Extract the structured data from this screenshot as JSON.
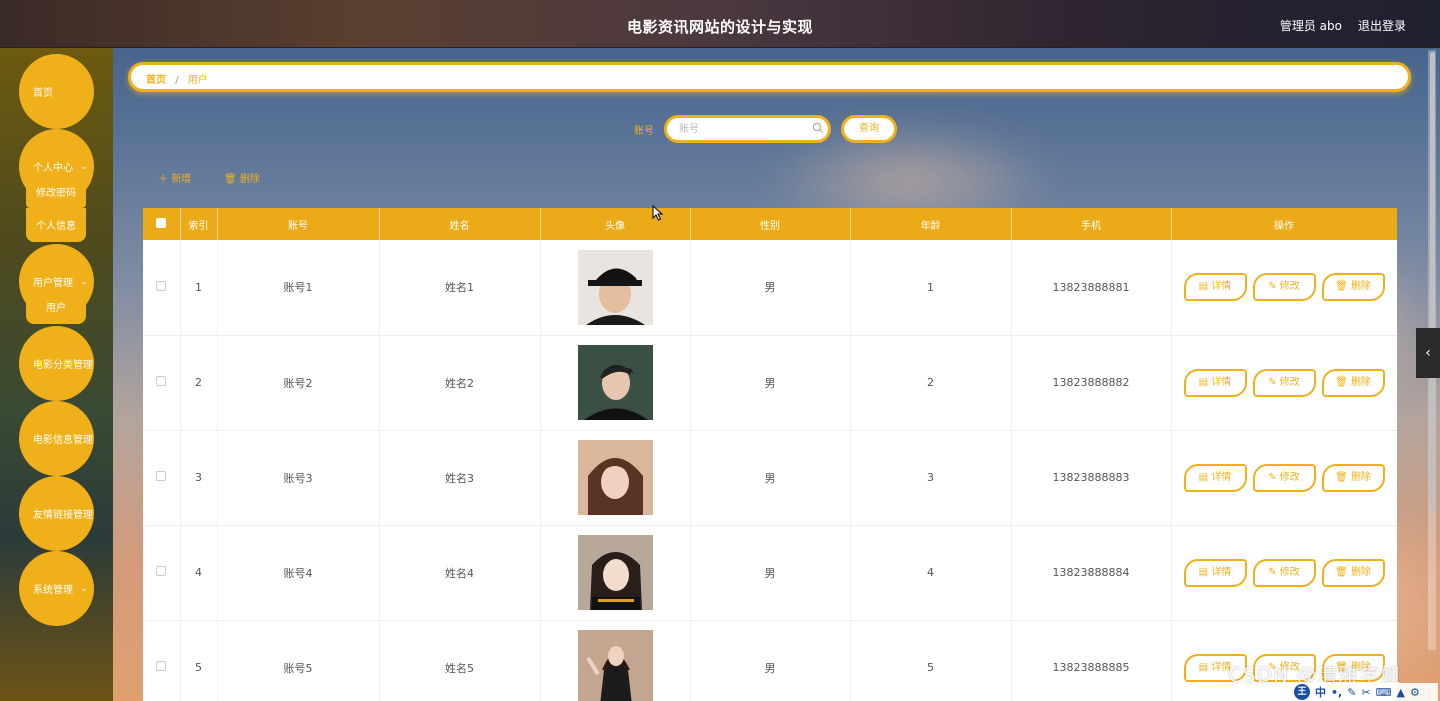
{
  "header": {
    "title": "电影资讯网站的设计与实现",
    "user": "管理员 abo",
    "logout": "退出登录"
  },
  "sidebar": {
    "items": [
      {
        "label": "首页",
        "has_children": false
      },
      {
        "label": "个人中心",
        "has_children": true,
        "children": [
          "修改密码",
          "个人信息"
        ]
      },
      {
        "label": "用户管理",
        "has_children": true,
        "children": [
          "用户"
        ]
      },
      {
        "label": "电影分类管理",
        "has_children": false
      },
      {
        "label": "电影信息管理",
        "has_children": false
      },
      {
        "label": "友情链接管理",
        "has_children": false
      },
      {
        "label": "系统管理",
        "has_children": true
      }
    ]
  },
  "breadcrumb": {
    "home": "首页",
    "separator": "/",
    "current": "用户"
  },
  "search": {
    "label": "账号",
    "placeholder": "账号",
    "button": "查询"
  },
  "actions": {
    "add": "新增",
    "delete": "删除"
  },
  "table": {
    "columns": [
      "索引",
      "账号",
      "姓名",
      "头像",
      "性别",
      "年龄",
      "手机",
      "操作"
    ],
    "rows": [
      {
        "index": "1",
        "account": "账号1",
        "name": "姓名1",
        "gender": "男",
        "age": "1",
        "phone": "13823888881"
      },
      {
        "index": "2",
        "account": "账号2",
        "name": "姓名2",
        "gender": "男",
        "age": "2",
        "phone": "13823888882"
      },
      {
        "index": "3",
        "account": "账号3",
        "name": "姓名3",
        "gender": "男",
        "age": "3",
        "phone": "13823888883"
      },
      {
        "index": "4",
        "account": "账号4",
        "name": "姓名4",
        "gender": "男",
        "age": "4",
        "phone": "13823888884"
      },
      {
        "index": "5",
        "account": "账号5",
        "name": "姓名5",
        "gender": "男",
        "age": "5",
        "phone": "13823888885"
      }
    ],
    "row_buttons": {
      "detail": "详情",
      "edit": "修改",
      "delete": "删除"
    }
  },
  "watermark": "CSDN @清雅学姐",
  "ime": {
    "logo": "王",
    "mode": "中"
  },
  "colors": {
    "accent": "#f0b01a",
    "header_row": "#ebaa18"
  }
}
